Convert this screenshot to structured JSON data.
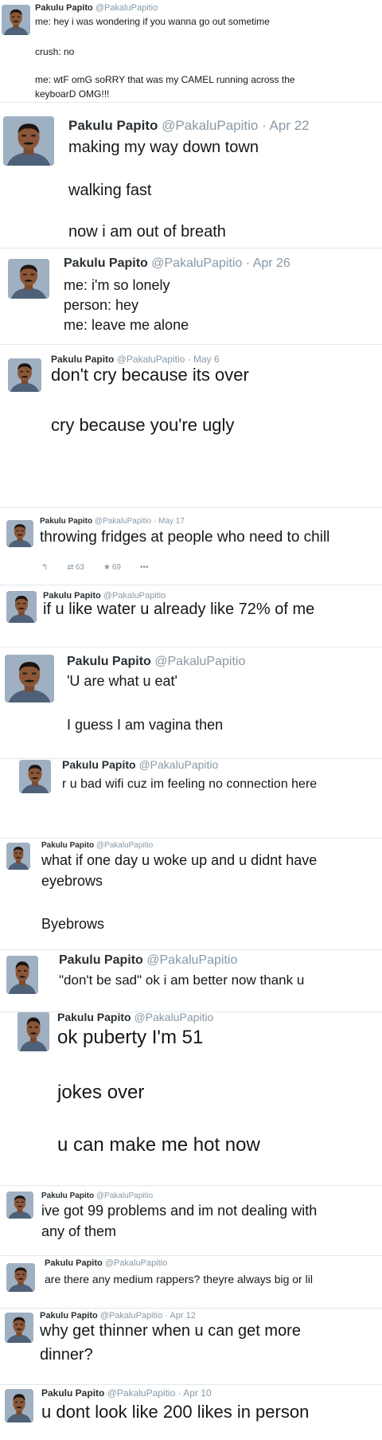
{
  "author": {
    "name": "Pakulu Papito",
    "handle": "@PakaluPapitio"
  },
  "tweets": [
    {
      "date": "",
      "lines": [
        "me: hey i was wondering if you wanna go out sometime",
        "crush: no",
        "me: wtF omG soRRY that was my CAMEL running across the",
        "keyboarD OMG!!!"
      ]
    },
    {
      "date": "Apr 22",
      "lines": [
        "making my way down town",
        "walking fast",
        "now i am out of breath"
      ]
    },
    {
      "date": "Apr 26",
      "lines": [
        "me: i'm so lonely",
        "person: hey",
        "me: leave me alone"
      ]
    },
    {
      "date": "May 6",
      "lines": [
        "don't cry because its over",
        "cry because you're ugly"
      ]
    },
    {
      "date": "May 17",
      "lines": [
        "throwing fridges at people who need to chill"
      ],
      "retweets": "63",
      "likes": "69"
    },
    {
      "date": "",
      "lines": [
        "if u like water u already like 72% of me"
      ]
    },
    {
      "date": "",
      "lines": [
        "'U are what u eat'",
        "I guess I am vagina then"
      ]
    },
    {
      "date": "",
      "lines": [
        "r u bad wifi cuz im feeling no connection here"
      ]
    },
    {
      "date": "",
      "lines": [
        "what if one day u woke up and u didnt have",
        "eyebrows",
        "Byebrows"
      ]
    },
    {
      "date": "",
      "lines": [
        "\"don't be sad\" ok i am better now thank u"
      ]
    },
    {
      "date": "",
      "lines": [
        "ok puberty I'm 51",
        "jokes over",
        "u can make me hot now"
      ]
    },
    {
      "date": "",
      "lines": [
        "ive got 99 problems and im not dealing with",
        "any of them"
      ]
    },
    {
      "date": "",
      "lines": [
        "are there any medium rappers? theyre always big or lil"
      ]
    },
    {
      "date": "Apr 12",
      "lines": [
        "why get thinner when u can get more",
        "dinner?"
      ]
    },
    {
      "date": "Apr 10",
      "lines": [
        "u dont look like 200 likes in person"
      ]
    }
  ],
  "icons": {
    "reply": "reply-icon",
    "retweet": "retweet-icon",
    "like": "star-icon",
    "more": "more-icon"
  },
  "colors": {
    "name": "#292f33",
    "handle": "#8899a6",
    "text": "#14171a",
    "separator": "#e1e8ed"
  }
}
